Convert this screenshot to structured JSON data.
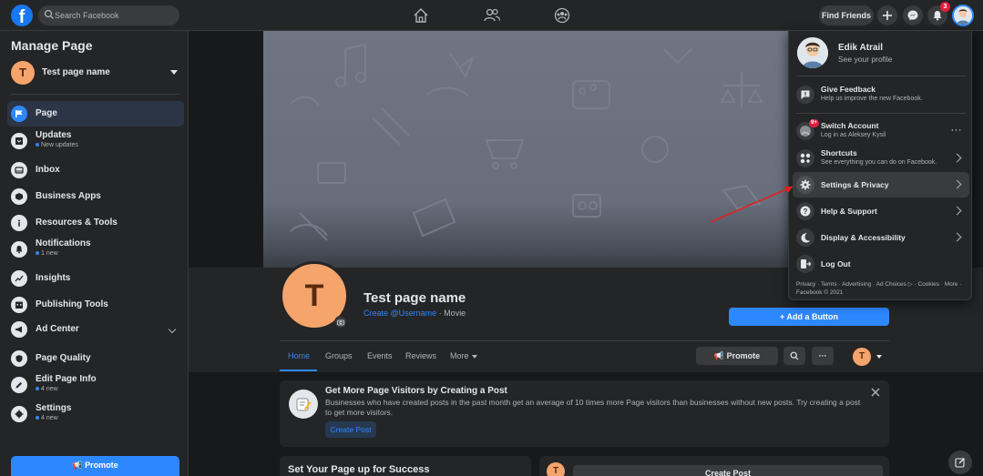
{
  "topbar": {
    "search_placeholder": "Search Facebook",
    "find_friends_label": "Find Friends",
    "notification_count": "3"
  },
  "sidebar": {
    "title": "Manage Page",
    "page": {
      "initial": "T",
      "name": "Test page name"
    },
    "items": [
      {
        "label": "Page",
        "sub": ""
      },
      {
        "label": "Updates",
        "sub": "New updates"
      },
      {
        "label": "Inbox",
        "sub": ""
      },
      {
        "label": "Business Apps",
        "sub": ""
      },
      {
        "label": "Resources & Tools",
        "sub": ""
      },
      {
        "label": "Notifications",
        "sub": "1 new"
      },
      {
        "label": "Insights",
        "sub": ""
      },
      {
        "label": "Publishing Tools",
        "sub": ""
      },
      {
        "label": "Ad Center",
        "sub": ""
      },
      {
        "label": "Page Quality",
        "sub": ""
      },
      {
        "label": "Edit Page Info",
        "sub": "4 new"
      },
      {
        "label": "Settings",
        "sub": "4 new"
      }
    ],
    "promote_label": "Promote"
  },
  "page": {
    "initial": "T",
    "name": "Test page name",
    "username_link": "Create @Username",
    "category": "· Movie",
    "add_button_label": "+ Add a Button",
    "tabs": [
      "Home",
      "Groups",
      "Events",
      "Reviews",
      "More"
    ],
    "promote_label": "Promote",
    "more_dots": "···",
    "visitors_card": {
      "title": "Get More Page Visitors by Creating a Post",
      "text": "Businesses who have created posts in the past month get an average of 10 times more Page visitors than businesses without new posts. Try creating a post to get more visitors.",
      "button": "Create Post"
    },
    "setup_title": "Set Your Page up for Success",
    "create_post_label": "Create Post"
  },
  "dropdown": {
    "profile_name": "Edik Atrail",
    "profile_sub": "See your profile",
    "feedback_label": "Give Feedback",
    "feedback_sub": "Help us improve the new Facebook.",
    "switch_label": "Switch Account",
    "switch_sub": "Log in as Aleksey Kysil",
    "switch_badge": "9+",
    "switch_dots": "···",
    "shortcuts_label": "Shortcuts",
    "shortcuts_sub": "See everything you can do on Facebook.",
    "settings_label": "Settings & Privacy",
    "help_label": "Help & Support",
    "display_label": "Display & Accessibility",
    "logout_label": "Log Out",
    "footer": "Privacy · Terms · Advertising · Ad Choices ▷ · Cookies · More · Facebook © 2021"
  },
  "colors": {
    "accent": "#2d88ff",
    "brand": "#1877f2",
    "avatar": "#f5a46c",
    "annotation_arrow": "#e0211d"
  }
}
